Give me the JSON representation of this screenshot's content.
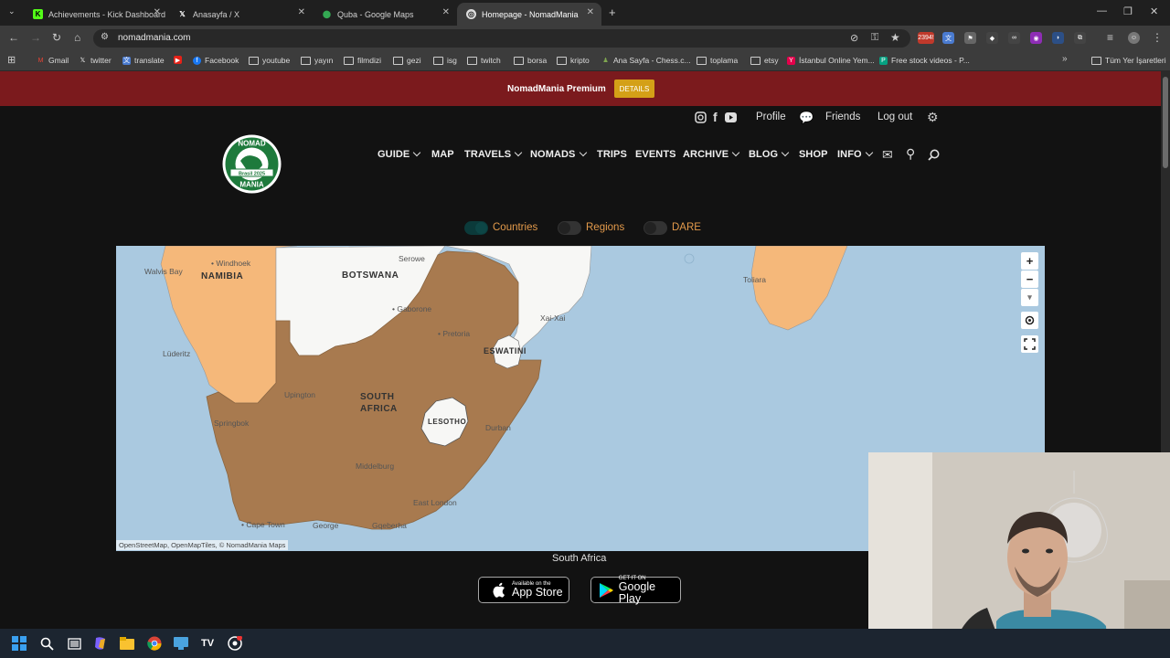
{
  "browser": {
    "tabs": [
      {
        "title": "Achievements - Kick Dashboard",
        "icon": "kick-icon",
        "active": false
      },
      {
        "title": "Anasayfa / X",
        "icon": "x-icon",
        "active": false
      },
      {
        "title": "Quba - Google Maps",
        "icon": "google-maps-icon",
        "active": false
      },
      {
        "title": "Homepage - NomadMania",
        "icon": "nomadmania-icon",
        "active": true
      }
    ],
    "new_tab": "+",
    "url": "nomadmania.com",
    "extension_badge": "2394!",
    "bookmarks": [
      {
        "label": "Gmail",
        "icon": "gmail-icon"
      },
      {
        "label": "twitter",
        "icon": "x-icon"
      },
      {
        "label": "translate",
        "icon": "translate-icon"
      },
      {
        "label": "",
        "icon": "youtube-icon"
      },
      {
        "label": "Facebook",
        "icon": "facebook-icon"
      },
      {
        "label": "youtube",
        "icon": "folder-icon"
      },
      {
        "label": "yayın",
        "icon": "folder-icon"
      },
      {
        "label": "filmdizi",
        "icon": "folder-icon"
      },
      {
        "label": "gezi",
        "icon": "folder-icon"
      },
      {
        "label": "isg",
        "icon": "folder-icon"
      },
      {
        "label": "twitch",
        "icon": "folder-icon"
      },
      {
        "label": "borsa",
        "icon": "folder-icon"
      },
      {
        "label": "kripto",
        "icon": "folder-icon"
      },
      {
        "label": "Ana Sayfa - Chess.c...",
        "icon": "chess-icon"
      },
      {
        "label": "toplama",
        "icon": "folder-icon"
      },
      {
        "label": "etsy",
        "icon": "folder-icon"
      },
      {
        "label": "İstanbul Online Yem...",
        "icon": "yemeksepeti-icon"
      },
      {
        "label": "Free stock videos - P...",
        "icon": "pexels-icon"
      }
    ],
    "all_bookmarks": "Tüm Yer İşaretleri"
  },
  "banner": {
    "text": "NomadMania Premium",
    "button": "DETAILS"
  },
  "topnav": {
    "profile": "Profile",
    "friends": "Friends",
    "logout": "Log out"
  },
  "logo": {
    "line1": "NOMAD",
    "line2": "MANIA",
    "ribbon": "Brasil 2025"
  },
  "mainnav": [
    {
      "label": "GUIDE",
      "dropdown": true
    },
    {
      "label": "MAP",
      "dropdown": false
    },
    {
      "label": "TRAVELS",
      "dropdown": true
    },
    {
      "label": "NOMADS",
      "dropdown": true
    },
    {
      "label": "TRIPS",
      "dropdown": false
    },
    {
      "label": "EVENTS",
      "dropdown": false
    },
    {
      "label": "ARCHIVE",
      "dropdown": true
    },
    {
      "label": "BLOG",
      "dropdown": true
    },
    {
      "label": "SHOP",
      "dropdown": false
    },
    {
      "label": "INFO",
      "dropdown": true
    }
  ],
  "toggles": [
    {
      "label": "Countries",
      "on": true
    },
    {
      "label": "Regions",
      "on": false
    },
    {
      "label": "DARE",
      "on": false
    }
  ],
  "map": {
    "countries": {
      "namibia": "NAMIBIA",
      "botswana": "BOTSWANA",
      "south_africa_1": "SOUTH",
      "south_africa_2": "AFRICA",
      "eswatini": "ESWATINI",
      "lesotho": "LESOTHO"
    },
    "places": [
      "Windhoek",
      "Walvis Bay",
      "Serowe",
      "Gaborone",
      "Pretoria",
      "Xai-Xai",
      "Lüderitz",
      "Upington",
      "Springbok",
      "Durban",
      "Middelburg",
      "East London",
      "Cape Town",
      "George",
      "Gqeberha",
      "Toliara"
    ],
    "controls": {
      "zoom_in": "+",
      "zoom_out": "−",
      "reset": "▾"
    },
    "attribution": "OpenStreetMap, OpenMapTiles, © NomadMania Maps",
    "colors": {
      "visited": "#a87a4f",
      "light_visited": "#f5b87a",
      "unvisited": "#f7f7f5",
      "sea": "#aac9e0"
    }
  },
  "caption": "South Africa",
  "stores": {
    "apple_small": "Available on the",
    "apple_big": "App Store",
    "google_small": "GET IT ON",
    "google_big": "Google Play"
  }
}
